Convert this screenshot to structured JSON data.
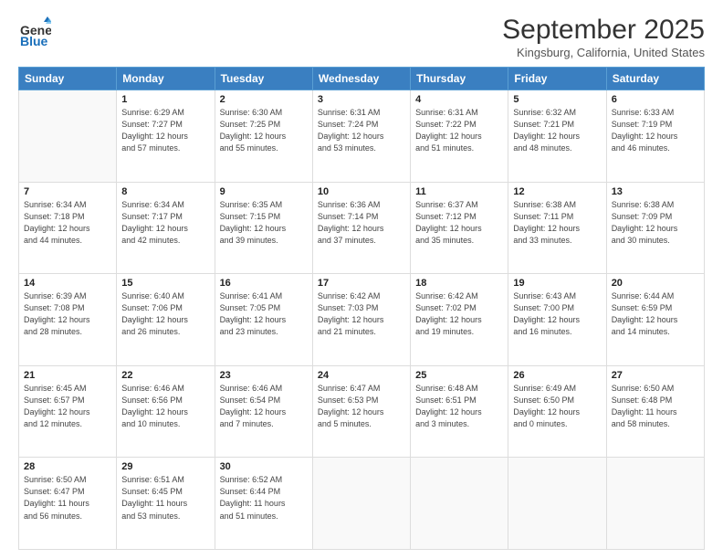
{
  "header": {
    "logo_general": "General",
    "logo_blue": "Blue",
    "month_title": "September 2025",
    "location": "Kingsburg, California, United States"
  },
  "days_of_week": [
    "Sunday",
    "Monday",
    "Tuesday",
    "Wednesday",
    "Thursday",
    "Friday",
    "Saturday"
  ],
  "weeks": [
    [
      {
        "day": "",
        "info": ""
      },
      {
        "day": "1",
        "info": "Sunrise: 6:29 AM\nSunset: 7:27 PM\nDaylight: 12 hours\nand 57 minutes."
      },
      {
        "day": "2",
        "info": "Sunrise: 6:30 AM\nSunset: 7:25 PM\nDaylight: 12 hours\nand 55 minutes."
      },
      {
        "day": "3",
        "info": "Sunrise: 6:31 AM\nSunset: 7:24 PM\nDaylight: 12 hours\nand 53 minutes."
      },
      {
        "day": "4",
        "info": "Sunrise: 6:31 AM\nSunset: 7:22 PM\nDaylight: 12 hours\nand 51 minutes."
      },
      {
        "day": "5",
        "info": "Sunrise: 6:32 AM\nSunset: 7:21 PM\nDaylight: 12 hours\nand 48 minutes."
      },
      {
        "day": "6",
        "info": "Sunrise: 6:33 AM\nSunset: 7:19 PM\nDaylight: 12 hours\nand 46 minutes."
      }
    ],
    [
      {
        "day": "7",
        "info": "Sunrise: 6:34 AM\nSunset: 7:18 PM\nDaylight: 12 hours\nand 44 minutes."
      },
      {
        "day": "8",
        "info": "Sunrise: 6:34 AM\nSunset: 7:17 PM\nDaylight: 12 hours\nand 42 minutes."
      },
      {
        "day": "9",
        "info": "Sunrise: 6:35 AM\nSunset: 7:15 PM\nDaylight: 12 hours\nand 39 minutes."
      },
      {
        "day": "10",
        "info": "Sunrise: 6:36 AM\nSunset: 7:14 PM\nDaylight: 12 hours\nand 37 minutes."
      },
      {
        "day": "11",
        "info": "Sunrise: 6:37 AM\nSunset: 7:12 PM\nDaylight: 12 hours\nand 35 minutes."
      },
      {
        "day": "12",
        "info": "Sunrise: 6:38 AM\nSunset: 7:11 PM\nDaylight: 12 hours\nand 33 minutes."
      },
      {
        "day": "13",
        "info": "Sunrise: 6:38 AM\nSunset: 7:09 PM\nDaylight: 12 hours\nand 30 minutes."
      }
    ],
    [
      {
        "day": "14",
        "info": "Sunrise: 6:39 AM\nSunset: 7:08 PM\nDaylight: 12 hours\nand 28 minutes."
      },
      {
        "day": "15",
        "info": "Sunrise: 6:40 AM\nSunset: 7:06 PM\nDaylight: 12 hours\nand 26 minutes."
      },
      {
        "day": "16",
        "info": "Sunrise: 6:41 AM\nSunset: 7:05 PM\nDaylight: 12 hours\nand 23 minutes."
      },
      {
        "day": "17",
        "info": "Sunrise: 6:42 AM\nSunset: 7:03 PM\nDaylight: 12 hours\nand 21 minutes."
      },
      {
        "day": "18",
        "info": "Sunrise: 6:42 AM\nSunset: 7:02 PM\nDaylight: 12 hours\nand 19 minutes."
      },
      {
        "day": "19",
        "info": "Sunrise: 6:43 AM\nSunset: 7:00 PM\nDaylight: 12 hours\nand 16 minutes."
      },
      {
        "day": "20",
        "info": "Sunrise: 6:44 AM\nSunset: 6:59 PM\nDaylight: 12 hours\nand 14 minutes."
      }
    ],
    [
      {
        "day": "21",
        "info": "Sunrise: 6:45 AM\nSunset: 6:57 PM\nDaylight: 12 hours\nand 12 minutes."
      },
      {
        "day": "22",
        "info": "Sunrise: 6:46 AM\nSunset: 6:56 PM\nDaylight: 12 hours\nand 10 minutes."
      },
      {
        "day": "23",
        "info": "Sunrise: 6:46 AM\nSunset: 6:54 PM\nDaylight: 12 hours\nand 7 minutes."
      },
      {
        "day": "24",
        "info": "Sunrise: 6:47 AM\nSunset: 6:53 PM\nDaylight: 12 hours\nand 5 minutes."
      },
      {
        "day": "25",
        "info": "Sunrise: 6:48 AM\nSunset: 6:51 PM\nDaylight: 12 hours\nand 3 minutes."
      },
      {
        "day": "26",
        "info": "Sunrise: 6:49 AM\nSunset: 6:50 PM\nDaylight: 12 hours\nand 0 minutes."
      },
      {
        "day": "27",
        "info": "Sunrise: 6:50 AM\nSunset: 6:48 PM\nDaylight: 11 hours\nand 58 minutes."
      }
    ],
    [
      {
        "day": "28",
        "info": "Sunrise: 6:50 AM\nSunset: 6:47 PM\nDaylight: 11 hours\nand 56 minutes."
      },
      {
        "day": "29",
        "info": "Sunrise: 6:51 AM\nSunset: 6:45 PM\nDaylight: 11 hours\nand 53 minutes."
      },
      {
        "day": "30",
        "info": "Sunrise: 6:52 AM\nSunset: 6:44 PM\nDaylight: 11 hours\nand 51 minutes."
      },
      {
        "day": "",
        "info": ""
      },
      {
        "day": "",
        "info": ""
      },
      {
        "day": "",
        "info": ""
      },
      {
        "day": "",
        "info": ""
      }
    ]
  ]
}
